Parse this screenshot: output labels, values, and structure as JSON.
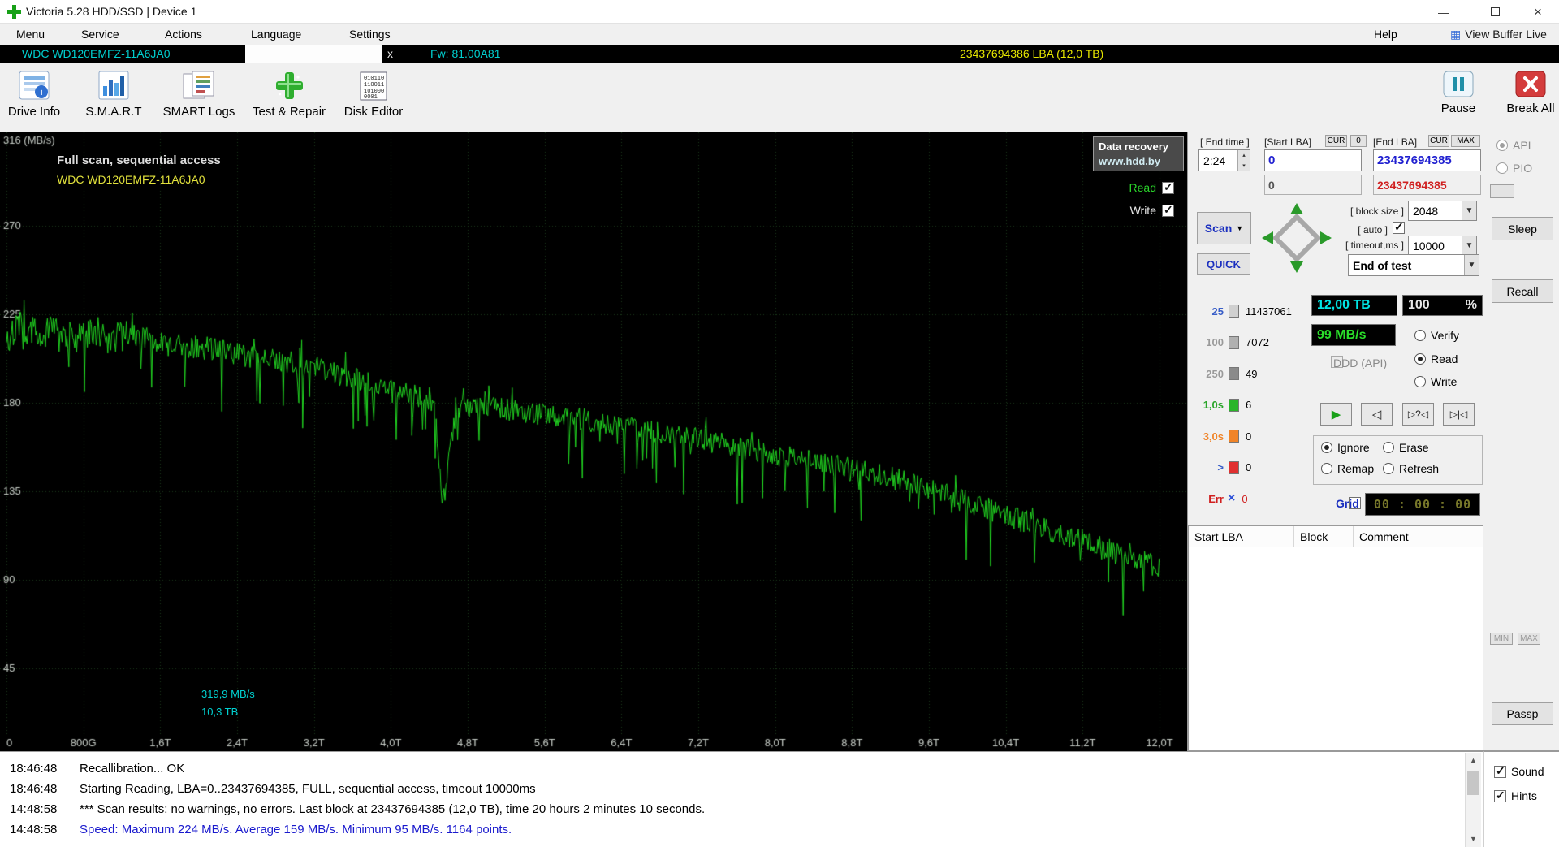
{
  "window": {
    "title": "Victoria 5.28 HDD/SSD | Device 1"
  },
  "menu": {
    "items": [
      "Menu",
      "Service",
      "Actions",
      "Language",
      "Settings"
    ],
    "help": "Help",
    "view_buffer_live": "View Buffer Live"
  },
  "device_bar": {
    "model": "WDC WD120EMFZ-11A6JA0",
    "close": "x",
    "firmware": "Fw: 81.00A81",
    "capacity": "23437694386 LBA (12,0 TB)"
  },
  "toolbar": {
    "items": [
      "Drive Info",
      "S.M.A.R.T",
      "SMART Logs",
      "Test & Repair",
      "Disk Editor"
    ],
    "pause": "Pause",
    "break_all": "Break All"
  },
  "graph": {
    "title": "Full scan, sequential access",
    "device": "WDC WD120EMFZ-11A6JA0",
    "watermark": [
      "Data recovery",
      "www.hdd.by"
    ],
    "legend": [
      {
        "label": "Read",
        "checked": true
      },
      {
        "label": "Write",
        "checked": true
      }
    ],
    "cursor": {
      "speed": "319,9 MB/s",
      "position": "10,3 TB"
    }
  },
  "chart_data": {
    "type": "line",
    "title": "Full scan, sequential access",
    "series_name": "Read speed",
    "line_color": "#21d421",
    "x_unit": "TB",
    "y_unit": "MB/s",
    "xlim": [
      0,
      12
    ],
    "ylim": [
      0,
      316
    ],
    "grid": true,
    "y_ticks": [
      {
        "v": 316,
        "label": "316 (MB/s)"
      },
      {
        "v": 270,
        "label": "270"
      },
      {
        "v": 225,
        "label": "225"
      },
      {
        "v": 180,
        "label": "180"
      },
      {
        "v": 135,
        "label": "135"
      },
      {
        "v": 90,
        "label": "90"
      },
      {
        "v": 45,
        "label": "45"
      }
    ],
    "x_ticks": [
      {
        "v": 0,
        "label": "0"
      },
      {
        "v": 0.8,
        "label": "800G"
      },
      {
        "v": 1.6,
        "label": "1,6T"
      },
      {
        "v": 2.4,
        "label": "2,4T"
      },
      {
        "v": 3.2,
        "label": "3,2T"
      },
      {
        "v": 4,
        "label": "4,0T"
      },
      {
        "v": 4.8,
        "label": "4,8T"
      },
      {
        "v": 5.6,
        "label": "5,6T"
      },
      {
        "v": 6.4,
        "label": "6,4T"
      },
      {
        "v": 7.2,
        "label": "7,2T"
      },
      {
        "v": 8,
        "label": "8,0T"
      },
      {
        "v": 8.8,
        "label": "8,8T"
      },
      {
        "v": 9.6,
        "label": "9,6T"
      },
      {
        "v": 10.4,
        "label": "10,4T"
      },
      {
        "v": 11.2,
        "label": "11,2T"
      },
      {
        "v": 12,
        "label": "12,0T"
      }
    ],
    "points": [
      [
        0,
        213
      ],
      [
        0.15,
        219
      ],
      [
        0.3,
        215
      ],
      [
        0.5,
        218
      ],
      [
        0.7,
        213
      ],
      [
        0.9,
        217
      ],
      [
        1.1,
        213
      ],
      [
        1.3,
        215
      ],
      [
        1.6,
        210
      ],
      [
        1.9,
        209
      ],
      [
        2.2,
        207
      ],
      [
        2.4,
        205
      ],
      [
        2.7,
        202
      ],
      [
        3,
        200
      ],
      [
        3.2,
        198
      ],
      [
        3.5,
        194
      ],
      [
        3.8,
        189
      ],
      [
        4,
        186
      ],
      [
        4.2,
        184
      ],
      [
        4.4,
        182
      ],
      [
        4.45,
        176
      ],
      [
        4.5,
        146
      ],
      [
        4.55,
        126
      ],
      [
        4.62,
        158
      ],
      [
        4.7,
        178
      ],
      [
        4.9,
        178
      ],
      [
        5.1,
        177
      ],
      [
        5.3,
        176
      ],
      [
        5.6,
        174
      ],
      [
        5.9,
        172
      ],
      [
        6.2,
        170
      ],
      [
        6.5,
        167
      ],
      [
        6.8,
        165
      ],
      [
        7.1,
        163
      ],
      [
        7.4,
        160
      ],
      [
        7.7,
        157
      ],
      [
        8,
        154
      ],
      [
        8.3,
        151
      ],
      [
        8.6,
        148
      ],
      [
        8.9,
        145
      ],
      [
        9.2,
        142
      ],
      [
        9.5,
        138
      ],
      [
        9.8,
        133
      ],
      [
        10.1,
        128
      ],
      [
        10.4,
        123
      ],
      [
        10.7,
        118
      ],
      [
        11,
        113
      ],
      [
        11.3,
        108
      ],
      [
        11.6,
        103
      ],
      [
        11.9,
        98
      ],
      [
        12,
        96
      ]
    ],
    "noise_amplitude": 6
  },
  "panel": {
    "end_time_label": "[ End time ]",
    "end_time_value": "2:24",
    "start_lba_label": "[Start LBA]",
    "cur_button": "CUR",
    "zero_button": "0",
    "start_lba_value": "0",
    "start_lba_current": "0",
    "end_lba_label": "[End LBA]",
    "max_button": "MAX",
    "end_lba_value": "23437694385",
    "end_lba_current": "23437694385",
    "api_label": "API",
    "pio_label": "PIO",
    "scan_button": "Scan",
    "quick_button": "QUICK",
    "block_size_label": "[ block size ]",
    "block_size_value": "2048",
    "auto_label": "[ auto ]",
    "auto_checked": true,
    "timeout_label": "[ timeout,ms ]",
    "timeout_value": "10000",
    "end_of_test_value": "End of test",
    "sleep_button": "Sleep",
    "recall_button": "Recall",
    "passp_button": "Passp",
    "lcd_capacity": "12,00 TB",
    "lcd_percent": "100",
    "lcd_percent_unit": "%",
    "lcd_speed": "99 MB/s",
    "lcd_timer": "00 : 00 : 00",
    "ddd_label": "DDD (API)",
    "mode_radios": [
      {
        "label": "Verify",
        "checked": false
      },
      {
        "label": "Read",
        "checked": true
      },
      {
        "label": "Write",
        "checked": false
      }
    ],
    "action_radios": [
      {
        "label": "Ignore",
        "checked": true
      },
      {
        "label": "Erase",
        "checked": false
      },
      {
        "label": "Remap",
        "checked": false
      },
      {
        "label": "Refresh",
        "checked": false
      }
    ],
    "grid_label": "Grid",
    "counters": [
      {
        "label": "25",
        "value": "11437061",
        "chip": "#d0d0d0",
        "label_color": "#3a5fc8",
        "value_color": "#000000"
      },
      {
        "label": "100",
        "value": "7072",
        "chip": "#b0b0b0",
        "label_color": "#9a9a9a",
        "value_color": "#000000"
      },
      {
        "label": "250",
        "value": "49",
        "chip": "#8a8a8a",
        "label_color": "#9a9a9a",
        "value_color": "#000000"
      },
      {
        "label": "1,0s",
        "value": "6",
        "chip": "#2ab52a",
        "label_color": "#2aa52a",
        "value_color": "#000000"
      },
      {
        "label": "3,0s",
        "value": "0",
        "chip": "#f08428",
        "label_color": "#f08428",
        "value_color": "#000000"
      },
      {
        "label": ">",
        "value": "0",
        "chip": "#e03030",
        "label_color": "#3a5fc8",
        "value_color": "#000000"
      },
      {
        "label": "Err",
        "value": "0",
        "chip": "x",
        "label_color": "#d02020",
        "value_color": "#d02020"
      }
    ],
    "table_headers": [
      "Start LBA",
      "Block",
      "Comment"
    ]
  },
  "log": {
    "lines": [
      {
        "time": "18:46:48",
        "text": "Recallibration... OK",
        "color": "#000000"
      },
      {
        "time": "18:46:48",
        "text": "Starting Reading, LBA=0..23437694385, FULL, sequential access, timeout 10000ms",
        "color": "#000000"
      },
      {
        "time": "14:48:58",
        "text": "*** Scan results: no warnings, no errors. Last block at 23437694385 (12,0 TB), time 20 hours 2 minutes 10 seconds.",
        "color": "#000000"
      },
      {
        "time": "14:48:58",
        "text": "Speed: Maximum 224 MB/s. Average 159 MB/s. Minimum 95 MB/s. 1164 points.",
        "color": "#1a1acd"
      }
    ]
  },
  "misc": {
    "sound": "Sound",
    "hints": "Hints"
  }
}
